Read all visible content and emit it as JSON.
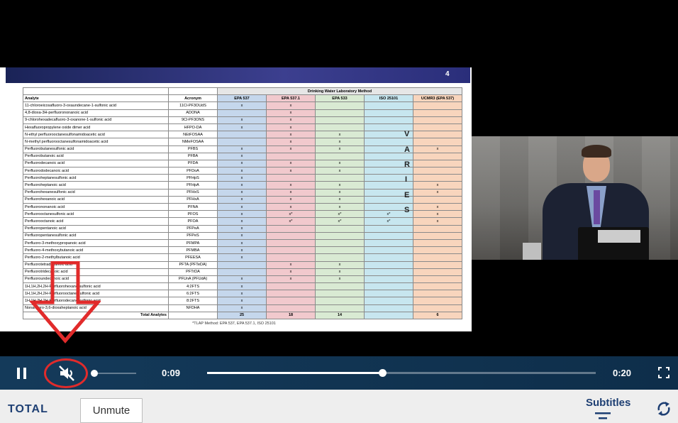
{
  "slide": {
    "page_number": "4",
    "group_header": "Drinking Water Laboratory Method",
    "col_analyte": "Analyte",
    "col_acronym": "Acronym",
    "methods": [
      "EPA 537",
      "EPA 537.1",
      "EPA 533",
      "ISO 25101",
      "UCMR3 (EPA 537)"
    ],
    "rows": [
      {
        "analyte": "11-chloroeicosafluoro-3-oxaundecane-1-sulfonic acid",
        "acronym": "11Cl-PF3OUdS",
        "marks": [
          "x",
          "x",
          "",
          "",
          ""
        ]
      },
      {
        "analyte": "4,8-dioxa-3H-perfluorononanoic acid",
        "acronym": "ADONA",
        "marks": [
          "",
          "x",
          "",
          "",
          ""
        ]
      },
      {
        "analyte": "9-chlorohexadecafluoro-3-oxanone-1-sulfonic acid",
        "acronym": "9Cl-PF3ONS",
        "marks": [
          "x",
          "x",
          "",
          "",
          ""
        ]
      },
      {
        "analyte": "Hexafluoropropylene oxide dimer acid",
        "acronym": "HFPO-DA",
        "marks": [
          "x",
          "x",
          "",
          "",
          ""
        ]
      },
      {
        "analyte": "N-ethyl perfluorooctanesulfonamidoacetic acid",
        "acronym": "NEtFOSAA",
        "marks": [
          "",
          "x",
          "x",
          "",
          ""
        ]
      },
      {
        "analyte": "N-methyl perfluorooctanesulfonamidoacetic acid",
        "acronym": "NMeFOSAA",
        "marks": [
          "",
          "x",
          "x",
          "",
          ""
        ]
      },
      {
        "analyte": "Perfluorobutanesulfonic acid",
        "acronym": "PFBS",
        "marks": [
          "x",
          "x",
          "x",
          "",
          "x"
        ]
      },
      {
        "analyte": "Perfluorobutanoic acid",
        "acronym": "PFBA",
        "marks": [
          "x",
          "",
          "",
          "",
          ""
        ]
      },
      {
        "analyte": "Perfluorodecanoic acid",
        "acronym": "PFDA",
        "marks": [
          "x",
          "x",
          "x",
          "",
          ""
        ]
      },
      {
        "analyte": "Perfluorododecanoic acid",
        "acronym": "PFDoA",
        "marks": [
          "x",
          "x",
          "x",
          "",
          ""
        ]
      },
      {
        "analyte": "Perfluoroheptanesulfonic acid",
        "acronym": "PFHpS",
        "marks": [
          "x",
          "",
          "",
          "",
          ""
        ]
      },
      {
        "analyte": "Perfluoroheptanoic acid",
        "acronym": "PFHpA",
        "marks": [
          "x",
          "x",
          "x",
          "",
          "x"
        ]
      },
      {
        "analyte": "Perfluorohexanesulfonic acid",
        "acronym": "PFHxS",
        "marks": [
          "x",
          "x",
          "x",
          "",
          "x"
        ]
      },
      {
        "analyte": "Perfluorohexanoic acid",
        "acronym": "PFHxA",
        "marks": [
          "x",
          "x",
          "x",
          "",
          ""
        ]
      },
      {
        "analyte": "Perfluorononanoic acid",
        "acronym": "PFNA",
        "marks": [
          "x",
          "x",
          "x",
          "",
          "x"
        ]
      },
      {
        "analyte": "Perfluorooctanesulfonic acid",
        "acronym": "PFOS",
        "marks": [
          "x",
          "x*",
          "x*",
          "x*",
          "x"
        ]
      },
      {
        "analyte": "Perfluorooctanoic acid",
        "acronym": "PFOA",
        "marks": [
          "x",
          "x*",
          "x*",
          "x*",
          "x"
        ]
      },
      {
        "analyte": "Perfluoropentanoic acid",
        "acronym": "PFPeA",
        "marks": [
          "x",
          "",
          "",
          "",
          ""
        ]
      },
      {
        "analyte": "Perfluoropentanesulfonic acid",
        "acronym": "PFPeS",
        "marks": [
          "x",
          "",
          "",
          "",
          ""
        ]
      },
      {
        "analyte": "Perfluoro-3-methoxypropanoic acid",
        "acronym": "PFMPA",
        "marks": [
          "x",
          "",
          "",
          "",
          ""
        ]
      },
      {
        "analyte": "Perfluoro-4-methoxybutanoic acid",
        "acronym": "PFMBA",
        "marks": [
          "x",
          "",
          "",
          "",
          ""
        ]
      },
      {
        "analyte": "Perfluoro-2-methylbutanoic acid",
        "acronym": "PFEESA",
        "marks": [
          "x",
          "",
          "",
          "",
          ""
        ]
      },
      {
        "analyte": "Perfluorotetradecanoic acid",
        "acronym": "PFTA (PFTeDA)",
        "marks": [
          "",
          "x",
          "x",
          "",
          ""
        ]
      },
      {
        "analyte": "Perfluorotridecanoic acid",
        "acronym": "PFTrDA",
        "marks": [
          "",
          "x",
          "x",
          "",
          ""
        ]
      },
      {
        "analyte": "Perfluoroundecanoic acid",
        "acronym": "PFUnA (PFUdA)",
        "marks": [
          "x",
          "x",
          "x",
          "",
          ""
        ]
      },
      {
        "analyte": "1H,1H,2H,2H-Perfluorohexane sulfonic acid",
        "acronym": "4:2FTS",
        "marks": [
          "x",
          "",
          "",
          "",
          ""
        ]
      },
      {
        "analyte": "1H,1H,2H,2H-Perfluorooctane sulfonic acid",
        "acronym": "6:2FTS",
        "marks": [
          "x",
          "",
          "",
          "",
          ""
        ]
      },
      {
        "analyte": "1H,1H,2H,2H-Perfluorodecane sulfonic acid",
        "acronym": "8:2FTS",
        "marks": [
          "x",
          "",
          "",
          "",
          ""
        ]
      },
      {
        "analyte": "Nonafluoro-3,6-dioxaheptanoic acid",
        "acronym": "NFDHA",
        "marks": [
          "x",
          "",
          "",
          "",
          ""
        ]
      }
    ],
    "total_label": "Total Analytes",
    "totals": [
      "25",
      "18",
      "14",
      "",
      "6"
    ],
    "footnote": "*TLAP Method: EPA 537, EPA 537.1, ISO 25101",
    "overlay_letters": [
      "V",
      "A",
      "R",
      "I",
      "E",
      "S"
    ]
  },
  "player": {
    "current_time": "0:09",
    "duration": "0:20",
    "progress_fraction": 0.45,
    "volume_fraction": 0.0
  },
  "bottom_bar": {
    "logo": "TOTAL",
    "tooltip": "Unmute",
    "subtitles_label": "Subtitles"
  },
  "icons": {
    "pause": "pause-icon",
    "mute": "volume-muted-icon",
    "fullscreen": "fullscreen-icon",
    "subtitles": "subtitles-icon",
    "refresh": "refresh-icon"
  },
  "colors": {
    "annotation_red": "#e12b2b",
    "brand_blue": "#1e3f73",
    "control_bar": "#143a5a"
  }
}
